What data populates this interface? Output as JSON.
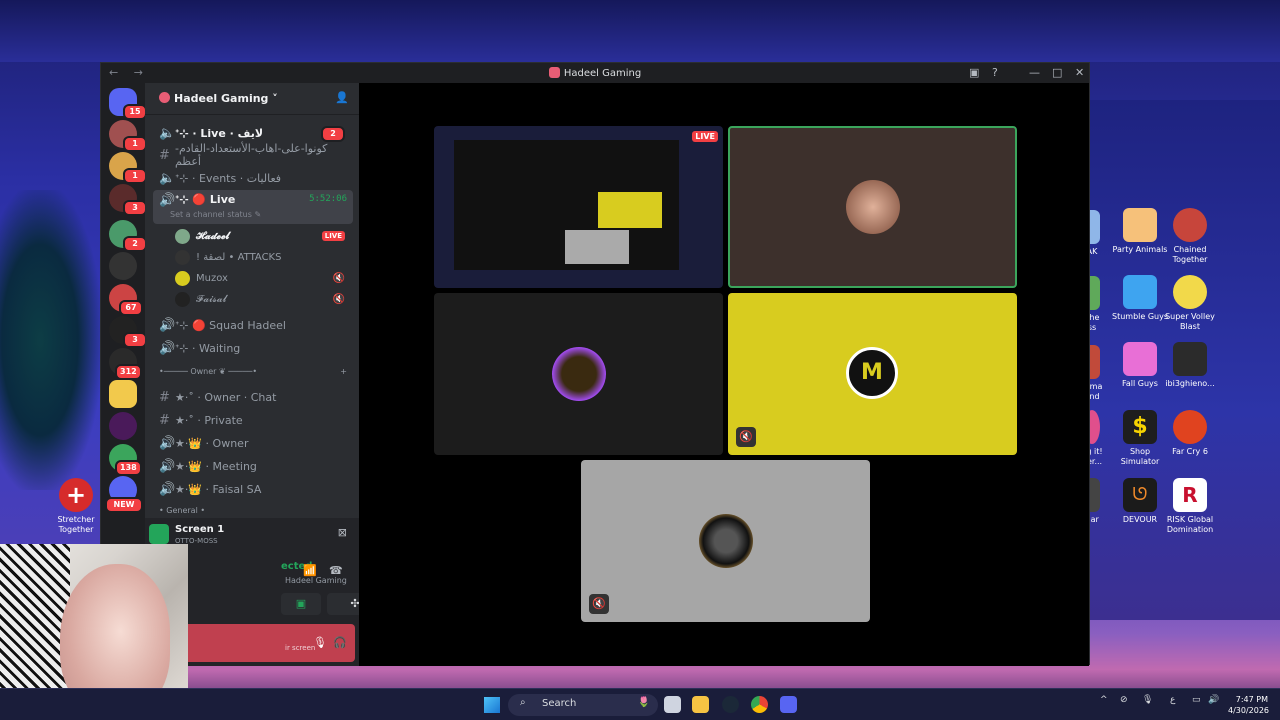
{
  "window": {
    "title": "Hadeel Gaming",
    "nav": "← →"
  },
  "server_badges": [
    "15",
    "1",
    "1",
    "3",
    "2",
    "67",
    "3",
    "312",
    "138"
  ],
  "guild": {
    "name": "Hadeel Gaming ˅"
  },
  "channels": [
    {
      "label": "ᐩ⊹ · Live · لايف",
      "badge": "2"
    },
    {
      "label": "كونوا-على-اهاب-الأستعداد-القادم-أعظم"
    },
    {
      "label": "ᐩ⊹ · Events · فعاليات"
    },
    {
      "label": "ᐩ⊹ 🔴 Live",
      "timer": "5:52:06",
      "status": "Set a channel status ✎"
    }
  ],
  "voice_users": [
    {
      "name": "𝓗𝓪𝓭𝓮𝓮𝓵",
      "live": "LIVE"
    },
    {
      "name": "! ﻟﺼﻘﺔ • ATTACKS"
    },
    {
      "name": "Muzox"
    },
    {
      "name": "𝓕𝓪𝓲𝓼𝓪𝓵"
    }
  ],
  "channels2": [
    {
      "label": "ᐩ⊹ 🔴 Squad Hadeel"
    },
    {
      "label": "ᐩ⊹ · Waiting"
    },
    {
      "label": "•───── Owner ❦ ─────•"
    },
    {
      "label": "★·˚ · Owner · Chat"
    },
    {
      "label": "★·˚ · Private"
    },
    {
      "label": "★·👑 · Owner"
    },
    {
      "label": "★·👑 · Meeting"
    },
    {
      "label": "★·👑 · Faisal SA"
    },
    {
      "label": "• General •"
    }
  ],
  "screen_share": {
    "title": "Screen 1",
    "subtitle": "OTTO-MOSS"
  },
  "voice_panel": {
    "connected": "ected",
    "server": "Hadeel Gaming",
    "share": "ir screen"
  },
  "stream": {
    "live": "LIVE"
  },
  "desktop_icons": [
    {
      "label": "Party Animals"
    },
    {
      "label": "Chained Together"
    },
    {
      "label": "Stumble Guys"
    },
    {
      "label": "Super Volley Blast"
    },
    {
      "label": "Fall Guys"
    },
    {
      "label": "ibi3ghieno..."
    },
    {
      "label": "Shop Simulator"
    },
    {
      "label": "Far Cry 6"
    },
    {
      "label": "DEVOUR"
    },
    {
      "label": "RISK Global Domination"
    },
    {
      "label": "Stretcher Together"
    }
  ],
  "desktop_partial": [
    "AK",
    "The ss",
    "arma end",
    "ng it! her...",
    "Bar"
  ],
  "new_badge": "NEW",
  "taskbar": {
    "search": "Search",
    "lang": "ع",
    "time": "7:47 PM",
    "date": "4/30/2026"
  },
  "colors": {
    "accent": "#5865f2",
    "live": "#f23f43",
    "connected": "#23a55a",
    "yellow": "#d8cc1f"
  }
}
